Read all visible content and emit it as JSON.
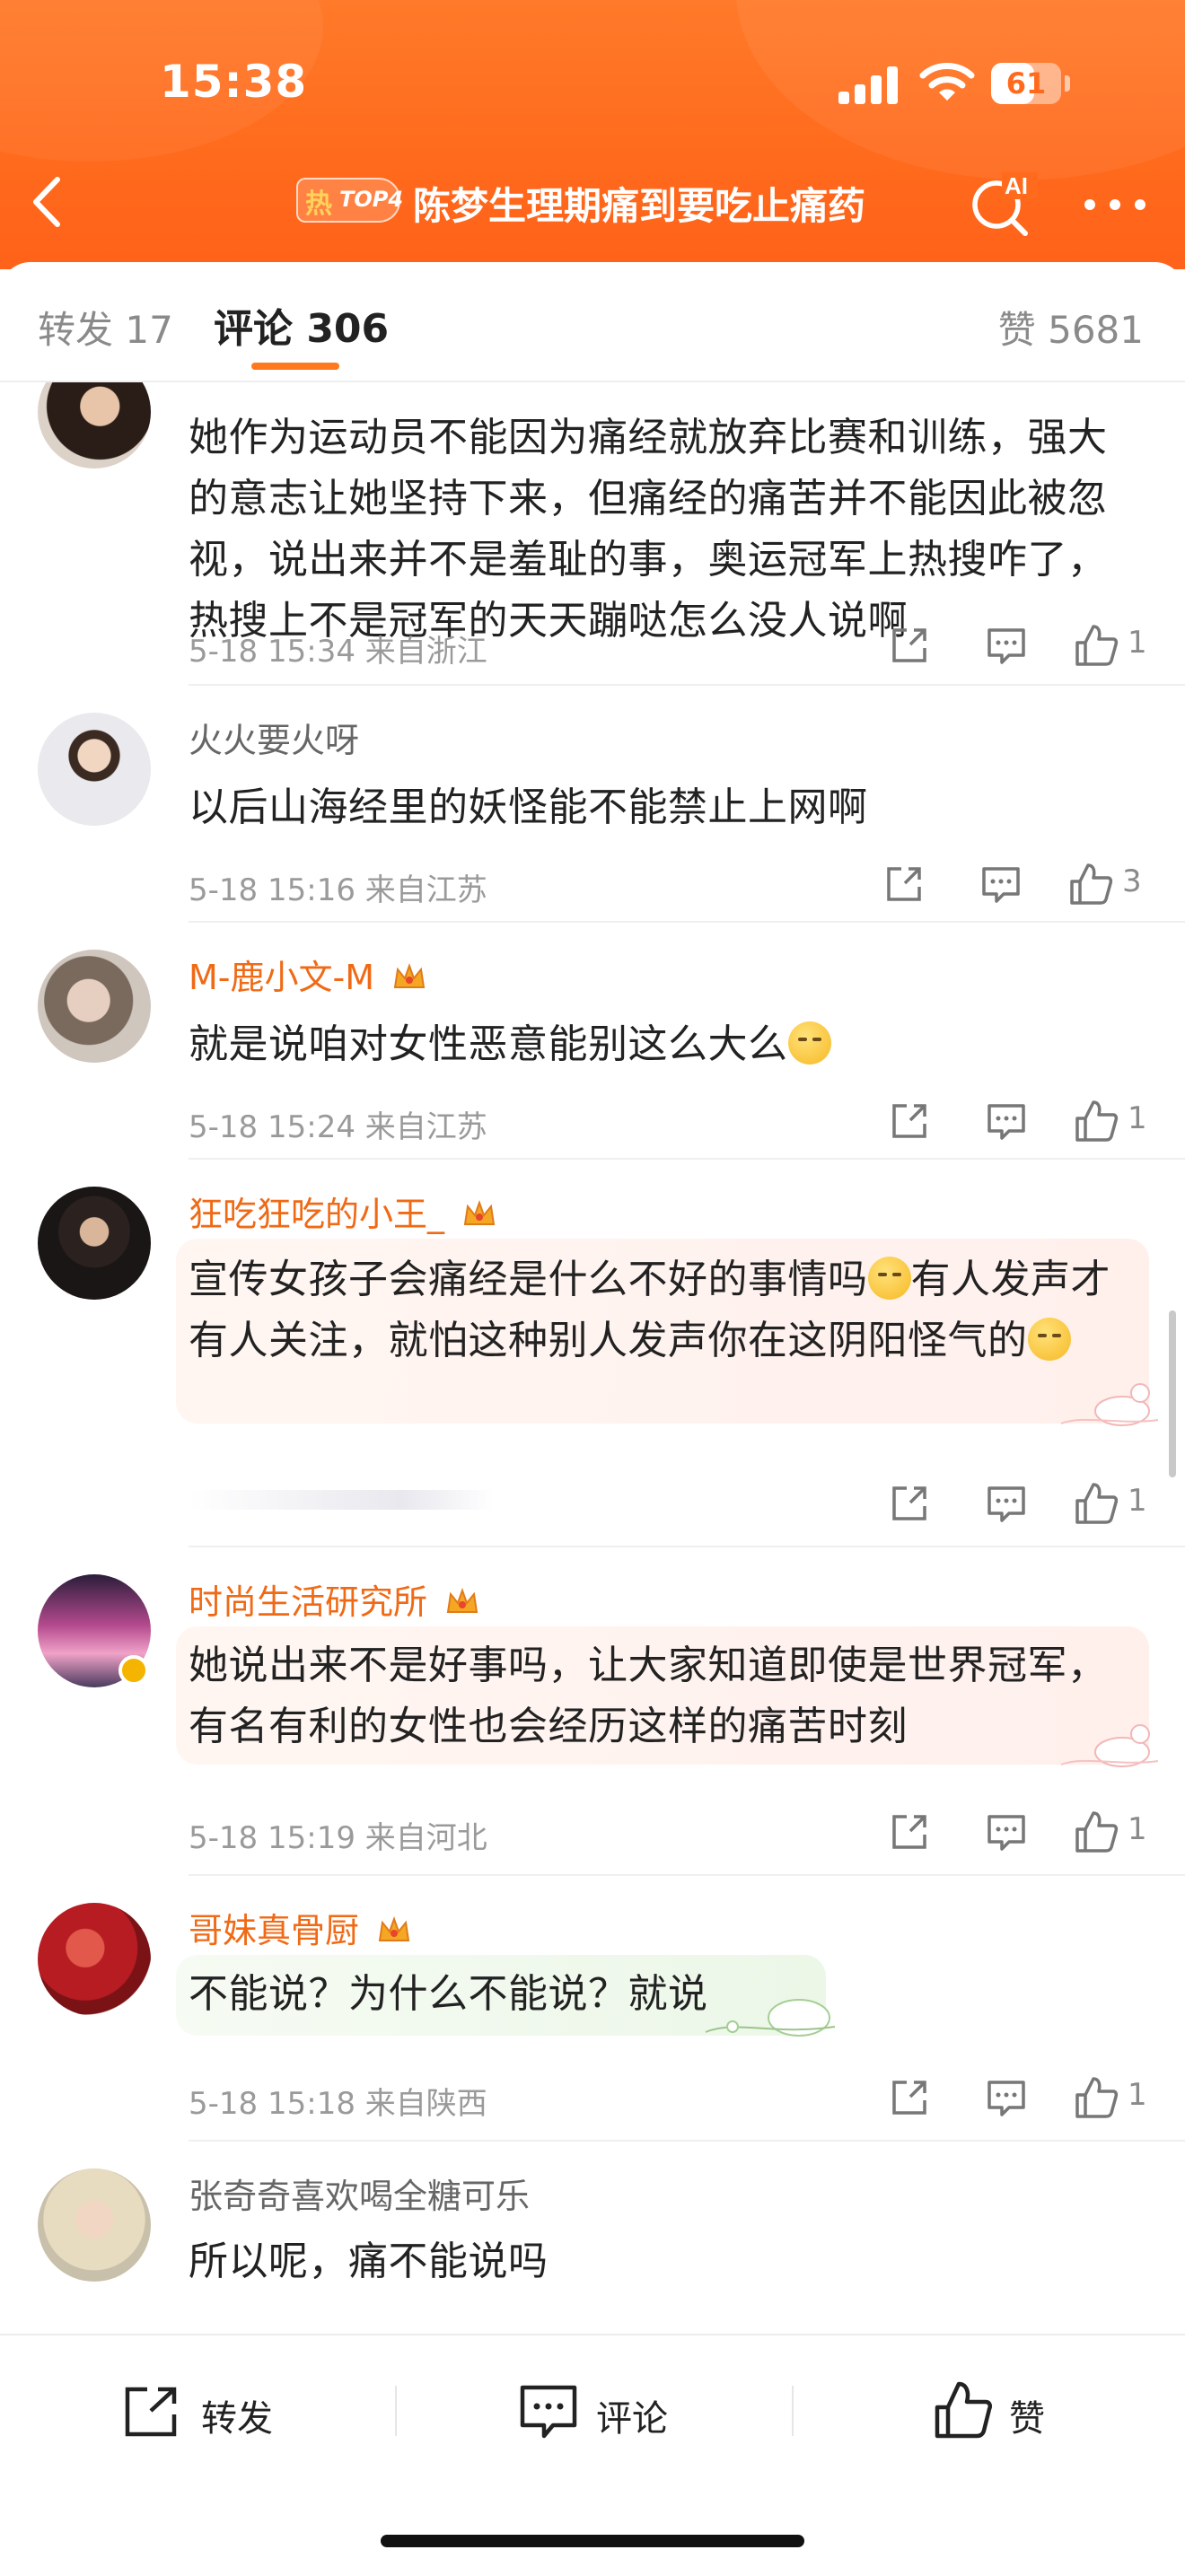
{
  "status_bar": {
    "time": "15:38",
    "battery": "61",
    "battery_fraction": 0.61
  },
  "nav": {
    "back_icon": "chevron-left-icon",
    "hot_label": "热",
    "hot_rank": "TOP4",
    "title": "陈梦生理期痛到要吃止痛药",
    "ai_search_label": "AI",
    "more_icon": "more-dots-icon"
  },
  "tabs": {
    "repost": "转发 17",
    "comments": "评论 306",
    "likes": "赞 5681"
  },
  "comments": [
    {
      "username": "",
      "text": "她作为运动员不能因为痛经就放弃比赛和训练，强大的意志让她坚持下来，但痛经的痛苦并不能因此被忽视，说出来并不是羞耻的事，奥运冠军上热搜咋了，热搜上不是冠军的天天蹦哒怎么没人说啊",
      "meta": "5-18 15:34 来自浙江",
      "likes": "1"
    },
    {
      "username": "火火要火呀",
      "text": "以后山海经里的妖怪能不能禁止上网啊",
      "meta": "5-18 15:16 来自江苏",
      "likes": "3"
    },
    {
      "username": "M-鹿小文-M",
      "text": "就是说咱对女性恶意能别这么大么",
      "meta": "5-18 15:24 来自江苏",
      "likes": "1"
    },
    {
      "username": "狂吃狂吃的小王_",
      "text_a": "宣传女孩子会痛经是什么不好的事情吗",
      "text_b": "有人发声才有人关注，就怕这种别人发声你在这阴阳怪气的",
      "meta": "",
      "likes": "1"
    },
    {
      "username": "时尚生活研究所",
      "text": "她说出来不是好事吗，让大家知道即使是世界冠军，有名有利的女性也会经历这样的痛苦时刻",
      "meta": "5-18 15:19 来自河北",
      "likes": "1"
    },
    {
      "username": "哥妹真骨厨",
      "text": "不能说？为什么不能说？就说",
      "meta": "5-18 15:18 来自陕西",
      "likes": "1"
    },
    {
      "username": "张奇奇喜欢喝全糖可乐",
      "text": "所以呢，痛不能说吗",
      "meta": "",
      "likes": ""
    }
  ],
  "bottom_bar": {
    "repost": "转发",
    "comment": "评论",
    "like": "赞"
  },
  "colors": {
    "header_orange": "#ff6a1c",
    "username_orange": "#f06a16",
    "accent_underline": "#ff7a1c"
  }
}
